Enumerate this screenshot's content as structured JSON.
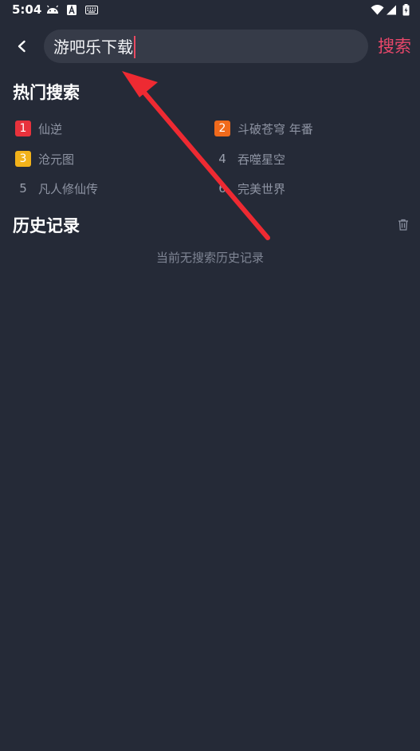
{
  "status_bar": {
    "time": "5:04",
    "left_icons": [
      "android-debug-icon",
      "font-a-icon",
      "keyboard-icon"
    ],
    "right_icons": [
      "wifi-icon",
      "cell-signal-icon",
      "battery-icon"
    ]
  },
  "search": {
    "query": "游吧乐下载",
    "submit_label": "搜索",
    "accent_color": "#e9476a"
  },
  "hot": {
    "title": "热门搜索",
    "items": [
      {
        "rank": "1",
        "label": "仙逆",
        "badge_color": "#e8323c"
      },
      {
        "rank": "2",
        "label": "斗破苍穹 年番",
        "badge_color": "#f06a1c"
      },
      {
        "rank": "3",
        "label": "沧元图",
        "badge_color": "#f2b21a"
      },
      {
        "rank": "4",
        "label": "吞噬星空"
      },
      {
        "rank": "5",
        "label": "凡人修仙传"
      },
      {
        "rank": "6",
        "label": "完美世界"
      }
    ]
  },
  "history": {
    "title": "历史记录",
    "empty_text": "当前无搜索历史记录",
    "clear_icon": "trash-icon"
  },
  "annotation": {
    "arrow_color": "#ee2a32"
  }
}
